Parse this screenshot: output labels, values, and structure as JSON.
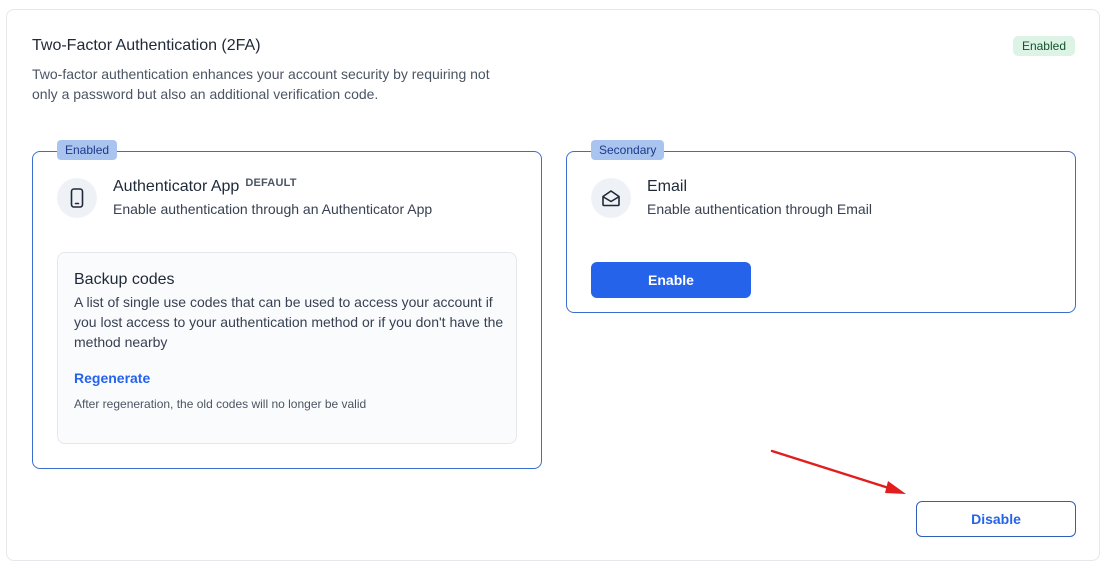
{
  "header": {
    "title": "Two-Factor Authentication (2FA)",
    "description": "Two-factor authentication enhances your account security by requiring not only a password but also an additional verification code.",
    "status_badge": "Enabled"
  },
  "methods": {
    "authenticator": {
      "tag": "Enabled",
      "name": "Authenticator App",
      "default_label": "DEFAULT",
      "description": "Enable authentication through an Authenticator App",
      "icon": "smartphone-icon",
      "backup": {
        "title": "Backup codes",
        "description": "A list of single use codes that can be used to access your account if you lost access to your authentication method or if you don't have the method nearby",
        "regenerate_label": "Regenerate",
        "note": "After regeneration, the old codes will no longer be valid"
      }
    },
    "email": {
      "tag": "Secondary",
      "name": "Email",
      "description": "Enable authentication through Email",
      "icon": "envelope-icon",
      "enable_label": "Enable"
    }
  },
  "actions": {
    "disable_label": "Disable"
  },
  "colors": {
    "accent": "#2563eb",
    "card_border": "#3b6fcf",
    "tag_bg": "#a9c4ef",
    "enabled_badge_bg": "#dcf3e6",
    "annotation_arrow": "#e11d1d"
  }
}
